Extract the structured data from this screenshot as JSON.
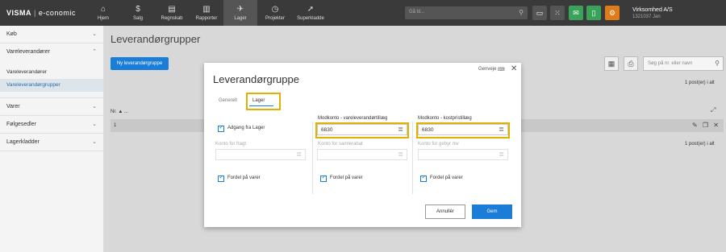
{
  "topbar": {
    "logo_brand": "VISMA",
    "logo_sep": "|",
    "logo_product": "e-conomic",
    "nav": [
      {
        "label": "Hjem",
        "icon": "home-icon"
      },
      {
        "label": "Salg",
        "icon": "dollar-icon"
      },
      {
        "label": "Regnskab",
        "icon": "ledger-icon"
      },
      {
        "label": "Rapporter",
        "icon": "bar-chart-icon"
      },
      {
        "label": "Lager",
        "icon": "plane-icon"
      },
      {
        "label": "Projekter",
        "icon": "clock-icon"
      },
      {
        "label": "Superkladde",
        "icon": "rocket-icon"
      }
    ],
    "search_placeholder": "Gå til...",
    "company_name": "Virksomhed A/S",
    "company_sub": "1321037 Jan"
  },
  "sidebar": {
    "items": [
      {
        "label": "Køb",
        "chevron": "⌄"
      },
      {
        "label": "Vareleverandører",
        "chevron": "⌃"
      }
    ],
    "subitems": [
      {
        "label": "Vareleverandører"
      },
      {
        "label": "Vareleverandørgrupper"
      }
    ],
    "items_bottom": [
      {
        "label": "Varer",
        "chevron": "⌄"
      },
      {
        "label": "Følgesedler",
        "chevron": "⌄"
      },
      {
        "label": "Lagerkladder",
        "chevron": "⌄"
      }
    ]
  },
  "main": {
    "title": "Leverandørgrupper",
    "new_button": "Ny leverandørgruppe",
    "search_placeholder": "Søg på nr. eller navn",
    "post_count_top": "1 post(er) i alt",
    "post_count_bottom": "1 post(er) i alt",
    "table_header": "Nr. ▲ ...",
    "row_no": "1"
  },
  "modal": {
    "title": "Leverandørgruppe",
    "shortcuts": "Genveje",
    "tabs": [
      "Generelt",
      "Lager"
    ],
    "col1": {
      "checkbox_label": "Adgang fra Lager",
      "field_label": "Konto for fragt",
      "field_value": "",
      "dist_label": "Fordel på varer"
    },
    "col2": {
      "label_a": "Modkonto - vareleverandørtillæg",
      "value_a": "6830",
      "label_b": "Konto for samlerabat",
      "value_b": "",
      "dist_label": "Fordel på varer"
    },
    "col3": {
      "label_a": "Modkonto - kostpristillæg",
      "value_a": "6830",
      "label_b": "Konto for gebyr mv",
      "value_b": "",
      "dist_label": "Fordel på varer"
    },
    "cancel_label": "Annullér",
    "save_label": "Gem"
  },
  "colors": {
    "accent": "#1a7dd7",
    "highlight": "#e2b000",
    "topbar": "#3a3a3a"
  }
}
